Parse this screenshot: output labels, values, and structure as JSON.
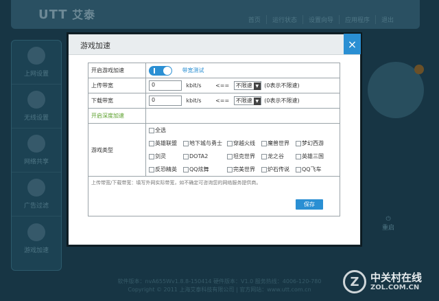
{
  "app": {
    "logo_text": "艾泰",
    "logo_mark": "UTT",
    "nav": [
      "首页",
      "运行状态",
      "设置向导",
      "应用程序",
      "退出"
    ]
  },
  "sidebar": {
    "items": [
      {
        "label": "上网设置",
        "icon": "globe-icon"
      },
      {
        "label": "无线设置",
        "icon": "wifi-icon"
      },
      {
        "label": "网络共享",
        "icon": "cloud-icon"
      },
      {
        "label": "广告过滤",
        "icon": "funnel-icon"
      },
      {
        "label": "游戏加速",
        "icon": "gamepad-icon"
      }
    ]
  },
  "right_panel": {
    "power_label": "重启"
  },
  "footer": {
    "line1": "软件版本：nvA655Wv1.8.8-150414 硬件版本：V1.0 服务热线：4006-120-780",
    "line2": "Copyright © 2011 上海艾泰科技有限公司 | 官方网站：www.utt.com.cn"
  },
  "watermark": {
    "brand": "中关村在线",
    "domain": "ZOL.COM.CN",
    "mark": "Z"
  },
  "modal": {
    "title": "游戏加速",
    "close": "×",
    "enable_label": "开启游戏加速",
    "bandwidth_test_link": "带宽测试",
    "upload_label": "上传带宽",
    "upload_value": "0",
    "download_label": "下载带宽",
    "download_value": "0",
    "unit": "kbit/s",
    "arrow": "<==",
    "limit_option": "不限速",
    "limit_note": "(0表示不限速)",
    "deep_accel_label": "开启深度加速",
    "game_type_label": "游戏类型",
    "select_all": "全选",
    "games": [
      [
        "英雄联盟",
        "地下城与勇士",
        "穿越火线",
        "魔兽世界",
        "梦幻西游"
      ],
      [
        "剑灵",
        "DOTA2",
        "坦克世界",
        "龙之谷",
        "英雄三国"
      ],
      [
        "反恐精英",
        "QQ炫舞",
        "完美世界",
        "炉石传说",
        "QQ飞车"
      ]
    ],
    "hint": "上传带宽/下载带宽：填写外网实际带宽，如不确定可咨询您的网络服务提供商。",
    "save_label": "保存",
    "accent": "#2a8fd3",
    "green": "#5a9f2a"
  }
}
